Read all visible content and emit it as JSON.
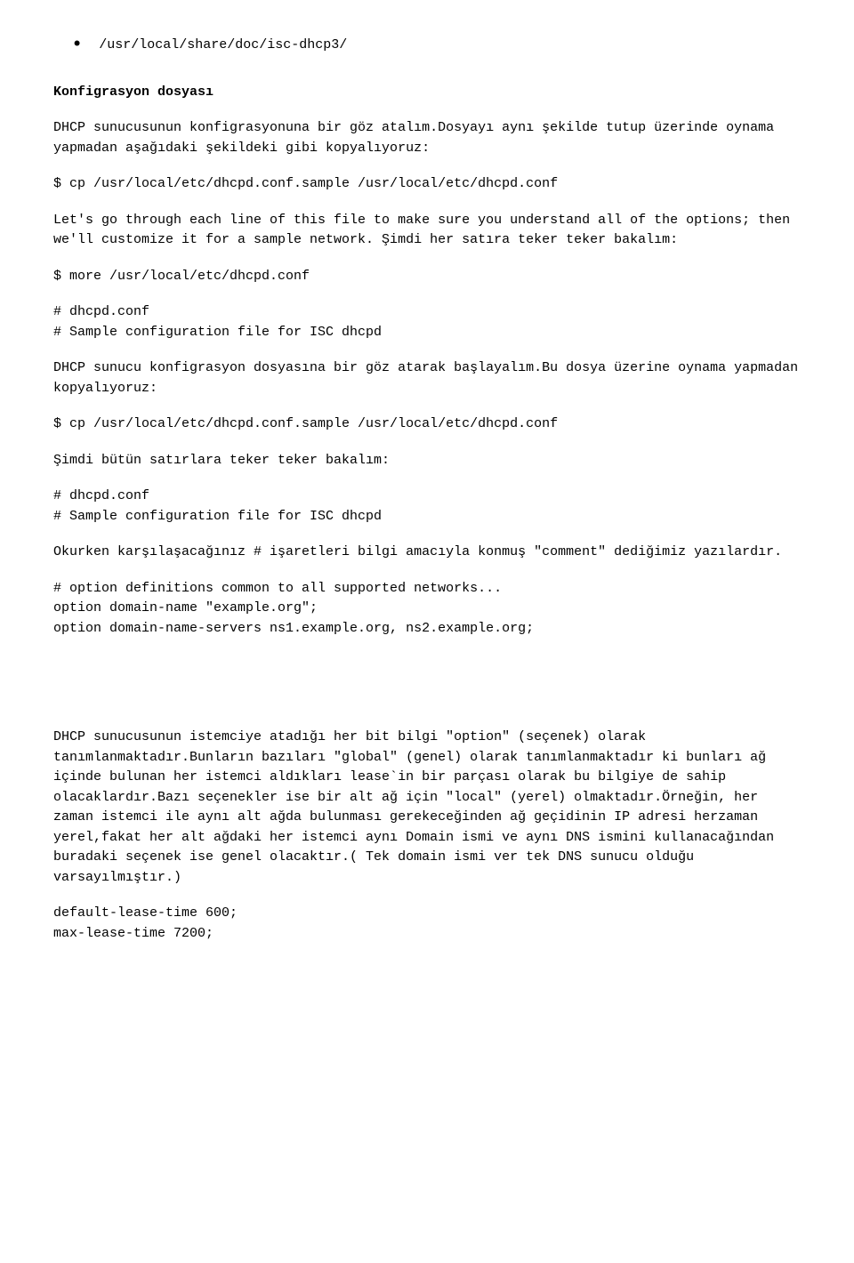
{
  "bulletPath": "/usr/local/share/doc/isc-dhcp3/",
  "heading1": "Konfigrasyon dosyası",
  "p1": "DHCP sunucusunun konfigrasyonuna bir göz atalım.Dosyayı aynı şekilde tutup üzerinde oynama yapmadan aşağıdaki şekildeki gibi kopyalıyoruz:",
  "cmd1": "$ cp /usr/local/etc/dhcpd.conf.sample /usr/local/etc/dhcpd.conf",
  "p2": "Let's go through each line of this file to make sure you understand all of the options; then we'll customize it for a sample network. Şimdi her satıra teker teker bakalım:",
  "cmd2": "$ more /usr/local/etc/dhcpd.conf",
  "comment1a": "# dhcpd.conf",
  "comment1b": "# Sample configuration file for ISC dhcpd",
  "p3": "DHCP sunucu konfigrasyon dosyasına bir göz atarak başlayalım.Bu dosya üzerine oynama yapmadan kopyalıyoruz:",
  "cmd3": "$ cp /usr/local/etc/dhcpd.conf.sample /usr/local/etc/dhcpd.conf",
  "p4": "Şimdi bütün satırlara teker teker bakalım:",
  "comment2a": "# dhcpd.conf",
  "comment2b": "# Sample configuration file for ISC dhcpd",
  "p5": "Okurken karşılaşacağınız # işaretleri bilgi amacıyla konmuş \"comment\" dediğimiz yazılardır.",
  "opt1": "# option definitions common to all supported networks...",
  "opt2": "option domain-name \"example.org\";",
  "opt3": "option domain-name-servers ns1.example.org, ns2.example.org;",
  "p6": "DHCP sunucusunun istemciye atadığı her bit bilgi \"option\" (seçenek) olarak tanımlanmaktadır.Bunların bazıları \"global\" (genel) olarak tanımlanmaktadır ki bunları ağ içinde bulunan her istemci aldıkları lease`in bir parçası olarak bu bilgiye de sahip olacaklardır.Bazı seçenekler ise bir alt ağ için \"local\" (yerel) olmaktadır.Örneğin, her zaman istemci ile aynı alt ağda bulunması gerekeceğinden ağ geçidinin IP adresi herzaman yerel,fakat her alt ağdaki her istemci aynı Domain ismi ve aynı DNS ismini kullanacağından buradaki seçenek ise genel olacaktır.( Tek domain ismi ver tek DNS sunucu olduğu varsayılmıştır.)",
  "lease1": "default-lease-time 600;",
  "lease2": "max-lease-time 7200;"
}
